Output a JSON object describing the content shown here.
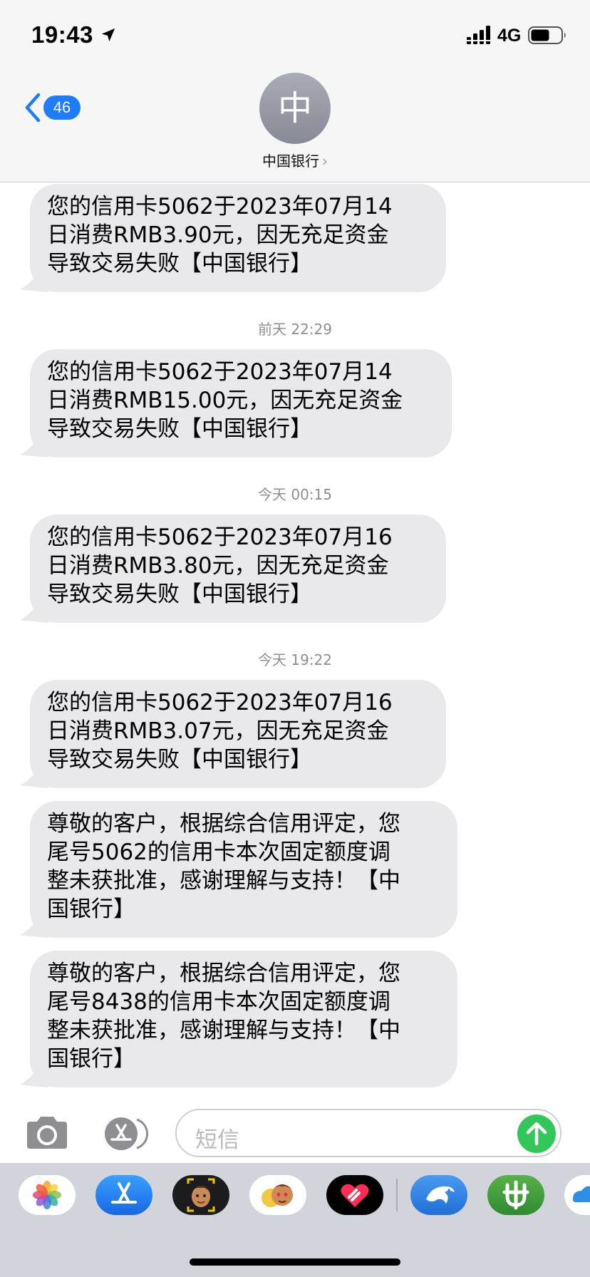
{
  "status_bar": {
    "time": "19:43",
    "network": "4G"
  },
  "nav": {
    "back_count": "46",
    "avatar_letter": "中",
    "contact_name": "中国银行",
    "contact_chevron": "›"
  },
  "messages": [
    {
      "lines": [
        "您的信用卡5062于2023年07月14",
        "日消费RMB3.90元，因无充足资金",
        "导致交易失败【中国银行】"
      ]
    },
    {
      "timestamp": "前天 22:29",
      "lines": [
        "您的信用卡5062于2023年07月14",
        "日消费RMB15.00元，因无充足资金",
        "导致交易失败【中国银行】"
      ]
    },
    {
      "timestamp": "今天 00:15",
      "lines": [
        "您的信用卡5062于2023年07月16",
        "日消费RMB3.80元，因无充足资金",
        "导致交易失败【中国银行】"
      ]
    },
    {
      "timestamp": "今天 19:22",
      "lines": [
        "您的信用卡5062于2023年07月16",
        "日消费RMB3.07元，因无充足资金",
        "导致交易失败【中国银行】"
      ]
    },
    {
      "lines": [
        "尊敬的客户，根据综合信用评定，您",
        "尾号5062的信用卡本次固定额度调",
        "整未获批准，感谢理解与支持！【中",
        "国银行】"
      ]
    },
    {
      "lines": [
        "尊敬的客户，根据综合信用评定，您",
        "尾号8438的信用卡本次固定额度调",
        "整未获批准，感谢理解与支持！【中",
        "国银行】"
      ]
    }
  ],
  "input": {
    "placeholder": "短信"
  },
  "app_drawer": {
    "apps": [
      "photos-icon",
      "app-store-icon",
      "memoji-icon",
      "animoji-icon",
      "digital-touch-icon",
      "dolphin-app-icon",
      "green-app-icon",
      "partial-blue-app-icon"
    ]
  },
  "colors": {
    "bubble_gray": "#e9e9eb",
    "badge_blue": "#1e7cf6",
    "send_green": "#33c759",
    "timestamp_gray": "#8e8e93"
  }
}
